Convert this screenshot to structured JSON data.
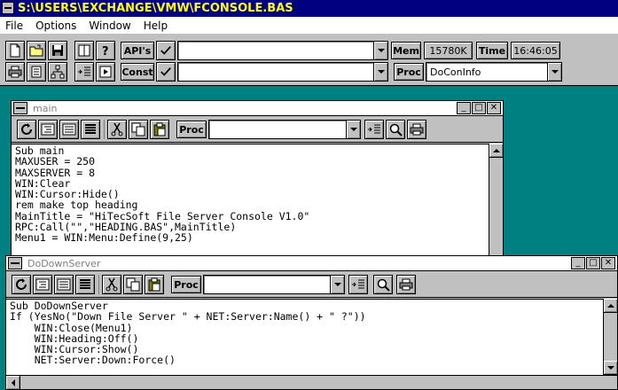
{
  "app": {
    "title": "S:\\USERS\\EXCHANGE\\VMW\\FCONSOLE.BAS"
  },
  "menu": {
    "items": [
      "File",
      "Options",
      "Window",
      "Help"
    ]
  },
  "toolbar": {
    "apis_label": "API's",
    "apis_value": "",
    "const_label": "Const",
    "const_value": "",
    "mem_label": "Mem",
    "mem_value": "15780K",
    "time_label": "Time",
    "time_value": "16:46:05",
    "proc_label": "Proc",
    "proc_value": "DoConInfo"
  },
  "windows": [
    {
      "title": "main",
      "proc_label": "Proc",
      "proc_value": "",
      "code": "Sub main\nMAXUSER = 250\nMAXSERVER = 8\nWIN:Clear\nWIN:Cursor:Hide()\nrem make top heading\nMainTitle = \"HiTecSoft File Server Console V1.0\"\nRPC:Call(\"\",\"HEADING.BAS\",MainTitle)\nMenu1 = WIN:Menu:Define(9,25)"
    },
    {
      "title": "DoDownServer",
      "proc_label": "Proc",
      "proc_value": "",
      "code": "Sub DoDownServer\nIf (YesNo(\"Down File Server \" + NET:Server:Name() + \" ?\"))\n    WIN:Close(Menu1)\n    WIN:Heading:Off()\n    WIN:Cursor:Show()\n    NET:Server:Down:Force()"
    }
  ],
  "icons": [
    "new-file-icon",
    "open-folder-icon",
    "save-disk-icon",
    "book-icon",
    "help-question-icon",
    "print-icon",
    "module-icon",
    "tree-icon",
    "step-list-icon",
    "run-icon",
    "check-icon",
    "refresh-icon",
    "indent-icon",
    "list-icon",
    "lines-icon",
    "cut-icon",
    "copy-icon",
    "paste-icon",
    "search-icon"
  ]
}
